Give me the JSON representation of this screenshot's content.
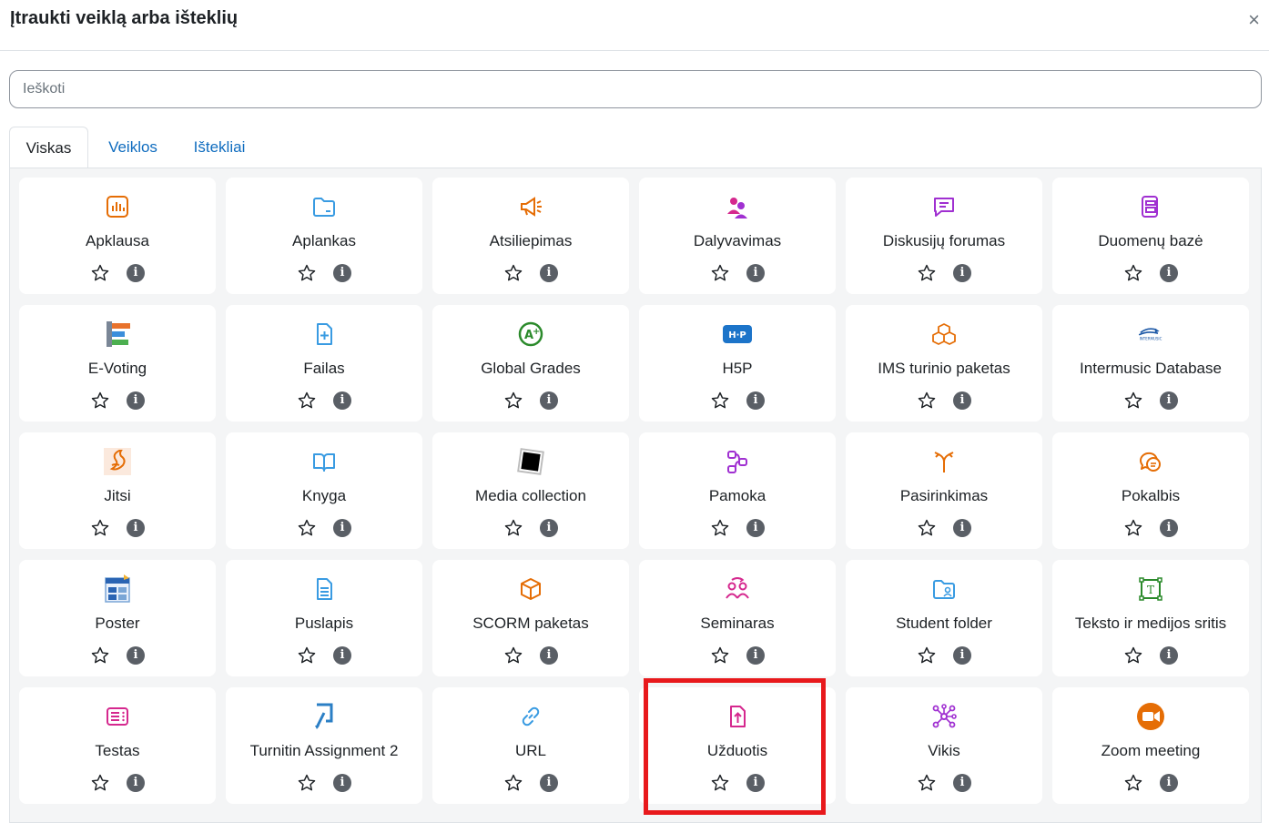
{
  "dialog": {
    "title": "Įtraukti veiklą arba išteklių",
    "close_glyph": "×"
  },
  "search": {
    "placeholder": "Ieškoti",
    "value": ""
  },
  "tabs": [
    {
      "label": "Viskas",
      "active": true
    },
    {
      "label": "Veiklos",
      "active": false
    },
    {
      "label": "Ištekliai",
      "active": false
    }
  ],
  "colors": {
    "orange": "#e56d05",
    "teal": "#399be2",
    "magenta": "#d5288e",
    "purple": "#a030d1",
    "green": "#2b8a2b",
    "highlight": "#e8191c"
  },
  "modules": [
    {
      "label": "Apklausa",
      "icon": "survey-icon"
    },
    {
      "label": "Aplankas",
      "icon": "folder-icon"
    },
    {
      "label": "Atsiliepimas",
      "icon": "megaphone-icon"
    },
    {
      "label": "Dalyvavimas",
      "icon": "attendance-icon"
    },
    {
      "label": "Diskusijų forumas",
      "icon": "forum-icon"
    },
    {
      "label": "Duomenų bazė",
      "icon": "database-icon"
    },
    {
      "label": "E-Voting",
      "icon": "evoting-icon"
    },
    {
      "label": "Failas",
      "icon": "file-icon"
    },
    {
      "label": "Global Grades",
      "icon": "global-grades-icon"
    },
    {
      "label": "H5P",
      "icon": "h5p-icon"
    },
    {
      "label": "IMS turinio paketas",
      "icon": "ims-package-icon"
    },
    {
      "label": "Intermusic Database",
      "icon": "intermusic-icon"
    },
    {
      "label": "Jitsi",
      "icon": "jitsi-icon"
    },
    {
      "label": "Knyga",
      "icon": "book-icon"
    },
    {
      "label": "Media collection",
      "icon": "media-collection-icon"
    },
    {
      "label": "Pamoka",
      "icon": "lesson-icon"
    },
    {
      "label": "Pasirinkimas",
      "icon": "choice-icon"
    },
    {
      "label": "Pokalbis",
      "icon": "chat-icon"
    },
    {
      "label": "Poster",
      "icon": "poster-icon"
    },
    {
      "label": "Puslapis",
      "icon": "page-icon"
    },
    {
      "label": "SCORM paketas",
      "icon": "scorm-icon"
    },
    {
      "label": "Seminaras",
      "icon": "workshop-icon"
    },
    {
      "label": "Student folder",
      "icon": "student-folder-icon"
    },
    {
      "label": "Teksto ir medijos sritis",
      "icon": "text-media-icon"
    },
    {
      "label": "Testas",
      "icon": "quiz-icon"
    },
    {
      "label": "Turnitin Assignment 2",
      "icon": "turnitin-icon"
    },
    {
      "label": "URL",
      "icon": "link-icon"
    },
    {
      "label": "Užduotis",
      "icon": "assignment-icon",
      "highlighted": true
    },
    {
      "label": "Vikis",
      "icon": "wiki-icon"
    },
    {
      "label": "Zoom meeting",
      "icon": "zoom-icon"
    }
  ],
  "info_glyph": "i"
}
